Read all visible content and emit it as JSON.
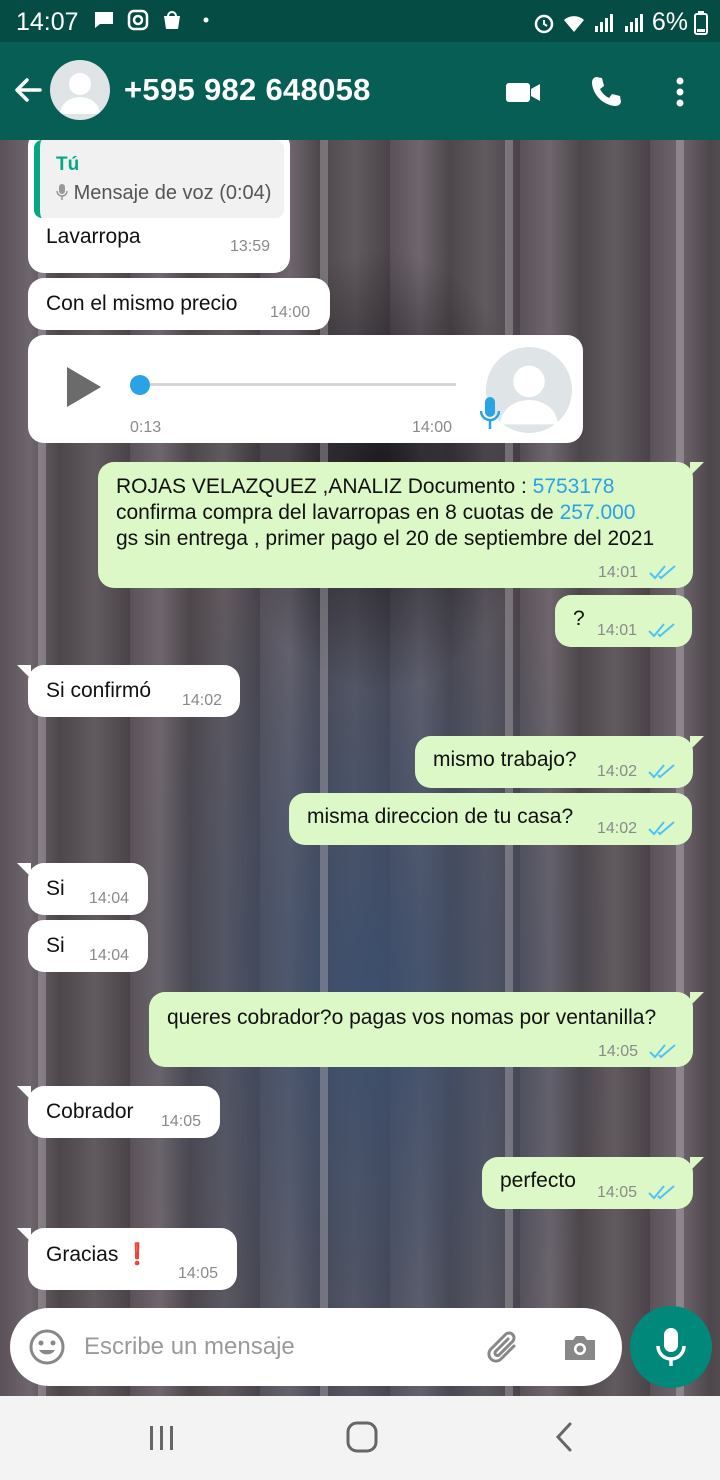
{
  "status_bar": {
    "time": "14:07",
    "battery": "6%",
    "left_icons": [
      "chat-icon",
      "instagram-icon",
      "bag-icon",
      "dot-icon"
    ],
    "right_icons": [
      "alarm-icon",
      "wifi-icon",
      "signal-icon",
      "signal-icon",
      "battery-icon"
    ]
  },
  "header": {
    "contact_name": "+595 982 648058",
    "icons": [
      "back-arrow-icon",
      "avatar-icon",
      "video-call-icon",
      "phone-icon",
      "more-vert-icon"
    ]
  },
  "messages": [
    {
      "direction": "in",
      "quote_author": "Tú",
      "quote_text": "Mensaje de voz (0:04)",
      "text": "Lavarropa",
      "time": "13:59"
    },
    {
      "direction": "in",
      "text": "Con el mismo precio",
      "time": "14:00"
    },
    {
      "direction": "in",
      "type": "voice",
      "duration": "0:13",
      "time": "14:00",
      "progress": 0
    },
    {
      "direction": "out",
      "lines": [
        "ROJAS VELAZQUEZ ,ANALIZ Documento : ",
        "5753178",
        "confirma compra del lavarropas en 8 cuotas de ",
        "257.000",
        "gs sin entrega , primer pago el 20 de septiembre del 2021"
      ],
      "time": "14:01",
      "status": "read"
    },
    {
      "direction": "out",
      "text": "?",
      "time": "14:01",
      "status": "read"
    },
    {
      "direction": "in",
      "text": "Si confirmó",
      "time": "14:02"
    },
    {
      "direction": "out",
      "text": "mismo trabajo?",
      "time": "14:02",
      "status": "read"
    },
    {
      "direction": "out",
      "text": "misma direccion de tu casa?",
      "time": "14:02",
      "status": "read"
    },
    {
      "direction": "in",
      "text": "Si",
      "time": "14:04"
    },
    {
      "direction": "in",
      "text": "Si",
      "time": "14:04"
    },
    {
      "direction": "out",
      "text": "queres cobrador?o pagas vos nomas por ventanilla?",
      "time": "14:05",
      "status": "read"
    },
    {
      "direction": "in",
      "text": "Cobrador",
      "time": "14:05"
    },
    {
      "direction": "out",
      "text": "perfecto",
      "time": "14:05",
      "status": "read"
    },
    {
      "direction": "in",
      "text": "Gracias",
      "emoji": "❗",
      "time": "14:05"
    }
  ],
  "composer": {
    "placeholder": "Escribe un mensaje",
    "icons": [
      "emoji-icon",
      "attach-icon",
      "camera-icon",
      "mic-icon"
    ]
  },
  "nav_bar": {
    "icons": [
      "recent-apps-icon",
      "home-icon",
      "back-icon"
    ]
  },
  "colors": {
    "header": "#075e54",
    "status_bar": "#054d44",
    "outgoing_bubble": "#dcf8c6",
    "incoming_bubble": "#ffffff",
    "read_ticks": "#4fc3f7",
    "link": "#2aa3e6",
    "mic_button": "#00897b"
  }
}
